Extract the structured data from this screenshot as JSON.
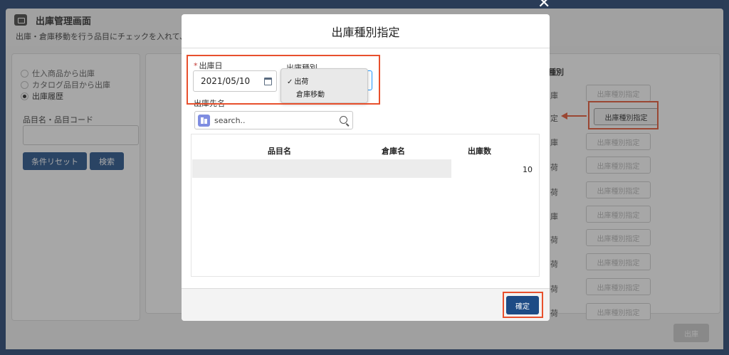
{
  "page": {
    "title": "出庫管理画面",
    "subtitle": "出庫・倉庫移動を行う品目にチェックを入れて、出"
  },
  "sidebar": {
    "radios": [
      {
        "label": "仕入商品から出庫",
        "checked": false
      },
      {
        "label": "カタログ品目から出庫",
        "checked": false
      },
      {
        "label": "出庫履歴",
        "checked": true
      }
    ],
    "field_label": "品目名・品目コード",
    "reset_button": "条件リセット",
    "search_button": "検索"
  },
  "list": {
    "column_header": "種別",
    "row_chars": [
      "庫",
      "定",
      "庫",
      "荷",
      "荷",
      "庫",
      "荷",
      "荷",
      "荷",
      "荷"
    ],
    "type_button_label": "出庫種別指定"
  },
  "ship_button": "出庫",
  "modal": {
    "close_symbol": "✕",
    "title": "出庫種別指定",
    "ship_date_label": "出庫日",
    "required_mark": "*",
    "ship_date_value": "2021/05/10",
    "ship_type_label": "出庫種別",
    "ship_type_options": [
      {
        "label": "出荷",
        "selected": true
      },
      {
        "label": "倉庫移動",
        "selected": false
      }
    ],
    "destination_label": "出庫先名",
    "search_placeholder": "search..",
    "table": {
      "headers": [
        "品目名",
        "倉庫名",
        "出庫数"
      ],
      "rows": [
        {
          "item": "",
          "warehouse": "",
          "qty": "10"
        }
      ]
    },
    "confirm_button": "確定"
  },
  "colors": {
    "primary": "#1d4b85",
    "annotation": "#e8502d",
    "page_background": "#1d3d6d"
  }
}
